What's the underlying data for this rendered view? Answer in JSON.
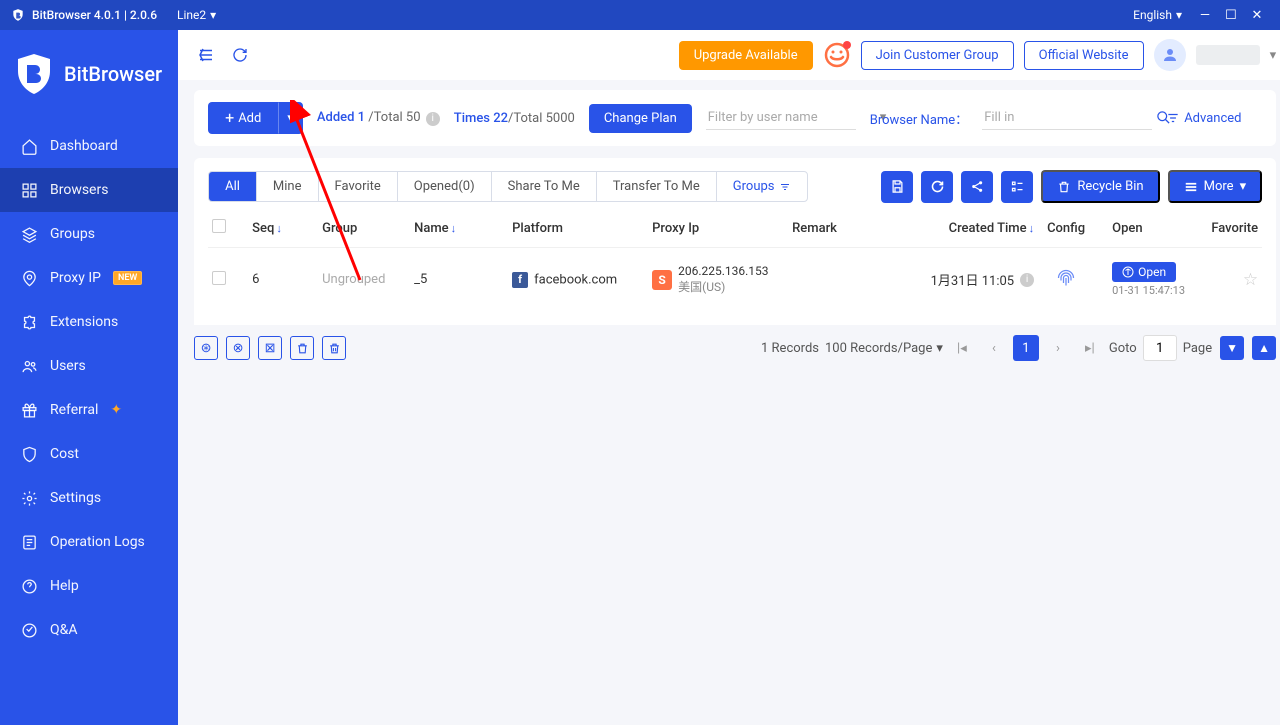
{
  "titlebar": {
    "app": "BitBrowser 4.0.1 | 2.0.6",
    "line": "Line2",
    "language": "English"
  },
  "brand": "BitBrowser",
  "nav": [
    {
      "icon": "home",
      "label": "Dashboard"
    },
    {
      "icon": "grid",
      "label": "Browsers",
      "active": true
    },
    {
      "icon": "layers",
      "label": "Groups"
    },
    {
      "icon": "pin",
      "label": "Proxy IP",
      "badge": "NEW"
    },
    {
      "icon": "puzzle",
      "label": "Extensions"
    },
    {
      "icon": "users",
      "label": "Users"
    },
    {
      "icon": "gift",
      "label": "Referral",
      "sparkle": true
    },
    {
      "icon": "shield",
      "label": "Cost"
    },
    {
      "icon": "gear",
      "label": "Settings"
    },
    {
      "icon": "log",
      "label": "Operation Logs"
    },
    {
      "icon": "help",
      "label": "Help"
    },
    {
      "icon": "qa",
      "label": "Q&A"
    }
  ],
  "topbar": {
    "upgrade": "Upgrade Available",
    "join": "Join Customer Group",
    "official": "Official Website"
  },
  "action": {
    "add": "Add",
    "added_label": "Added",
    "added_count": "1",
    "total_label": "/Total 50",
    "times_label": "Times",
    "times_count": "22",
    "total5000": "/Total 5000",
    "change_plan": "Change Plan",
    "filter_placeholder": "Filter by user name",
    "browser_name_label": "Browser Name：",
    "fill_placeholder": "Fill in",
    "advanced": "Advanced"
  },
  "tabs": [
    "All",
    "Mine",
    "Favorite",
    "Opened(0)",
    "Share To Me",
    "Transfer To Me"
  ],
  "groups_tab": "Groups",
  "recycle": "Recycle Bin",
  "more": "More",
  "columns": {
    "seq": "Seq",
    "group": "Group",
    "name": "Name",
    "platform": "Platform",
    "proxy": "Proxy Ip",
    "remark": "Remark",
    "created": "Created Time",
    "config": "Config",
    "open": "Open",
    "favorite": "Favorite"
  },
  "row": {
    "seq": "6",
    "group": "Ungrouped",
    "name": "_5",
    "platform": "facebook.com",
    "proxy_ip": "206.225.136.153",
    "proxy_loc": "美国(US)",
    "created": "1月31日 11:05",
    "open_label": "Open",
    "open_ts": "01-31 15:47:13"
  },
  "pager": {
    "records": "1 Records",
    "per_page": "100 Records/Page",
    "current": "1",
    "goto": "Goto",
    "goto_val": "1",
    "page": "Page"
  }
}
